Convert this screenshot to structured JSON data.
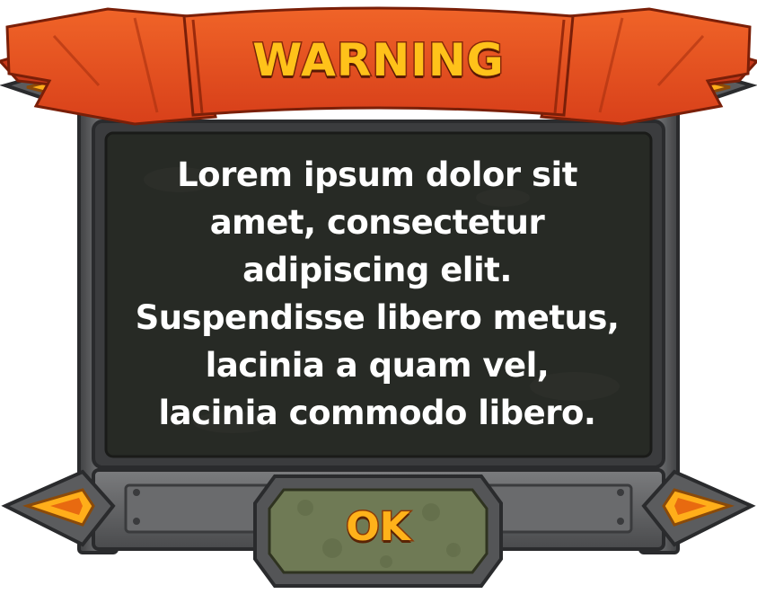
{
  "dialog": {
    "title": "WARNING",
    "message": "Lorem ipsum dolor sit\namet, consectetur\nadipiscing elit.\nSuspendisse libero metus,\nlacinia a quam vel,\nlacinia commodo libero.",
    "ok_label": "OK"
  },
  "colors": {
    "banner": "#e8501c",
    "panel": "#272a25",
    "frame": "#5c5d5f",
    "accent": "#ffb21a"
  },
  "icons": {
    "left_arrow": "left-triangle-ornament-icon",
    "right_arrow": "right-triangle-ornament-icon"
  }
}
